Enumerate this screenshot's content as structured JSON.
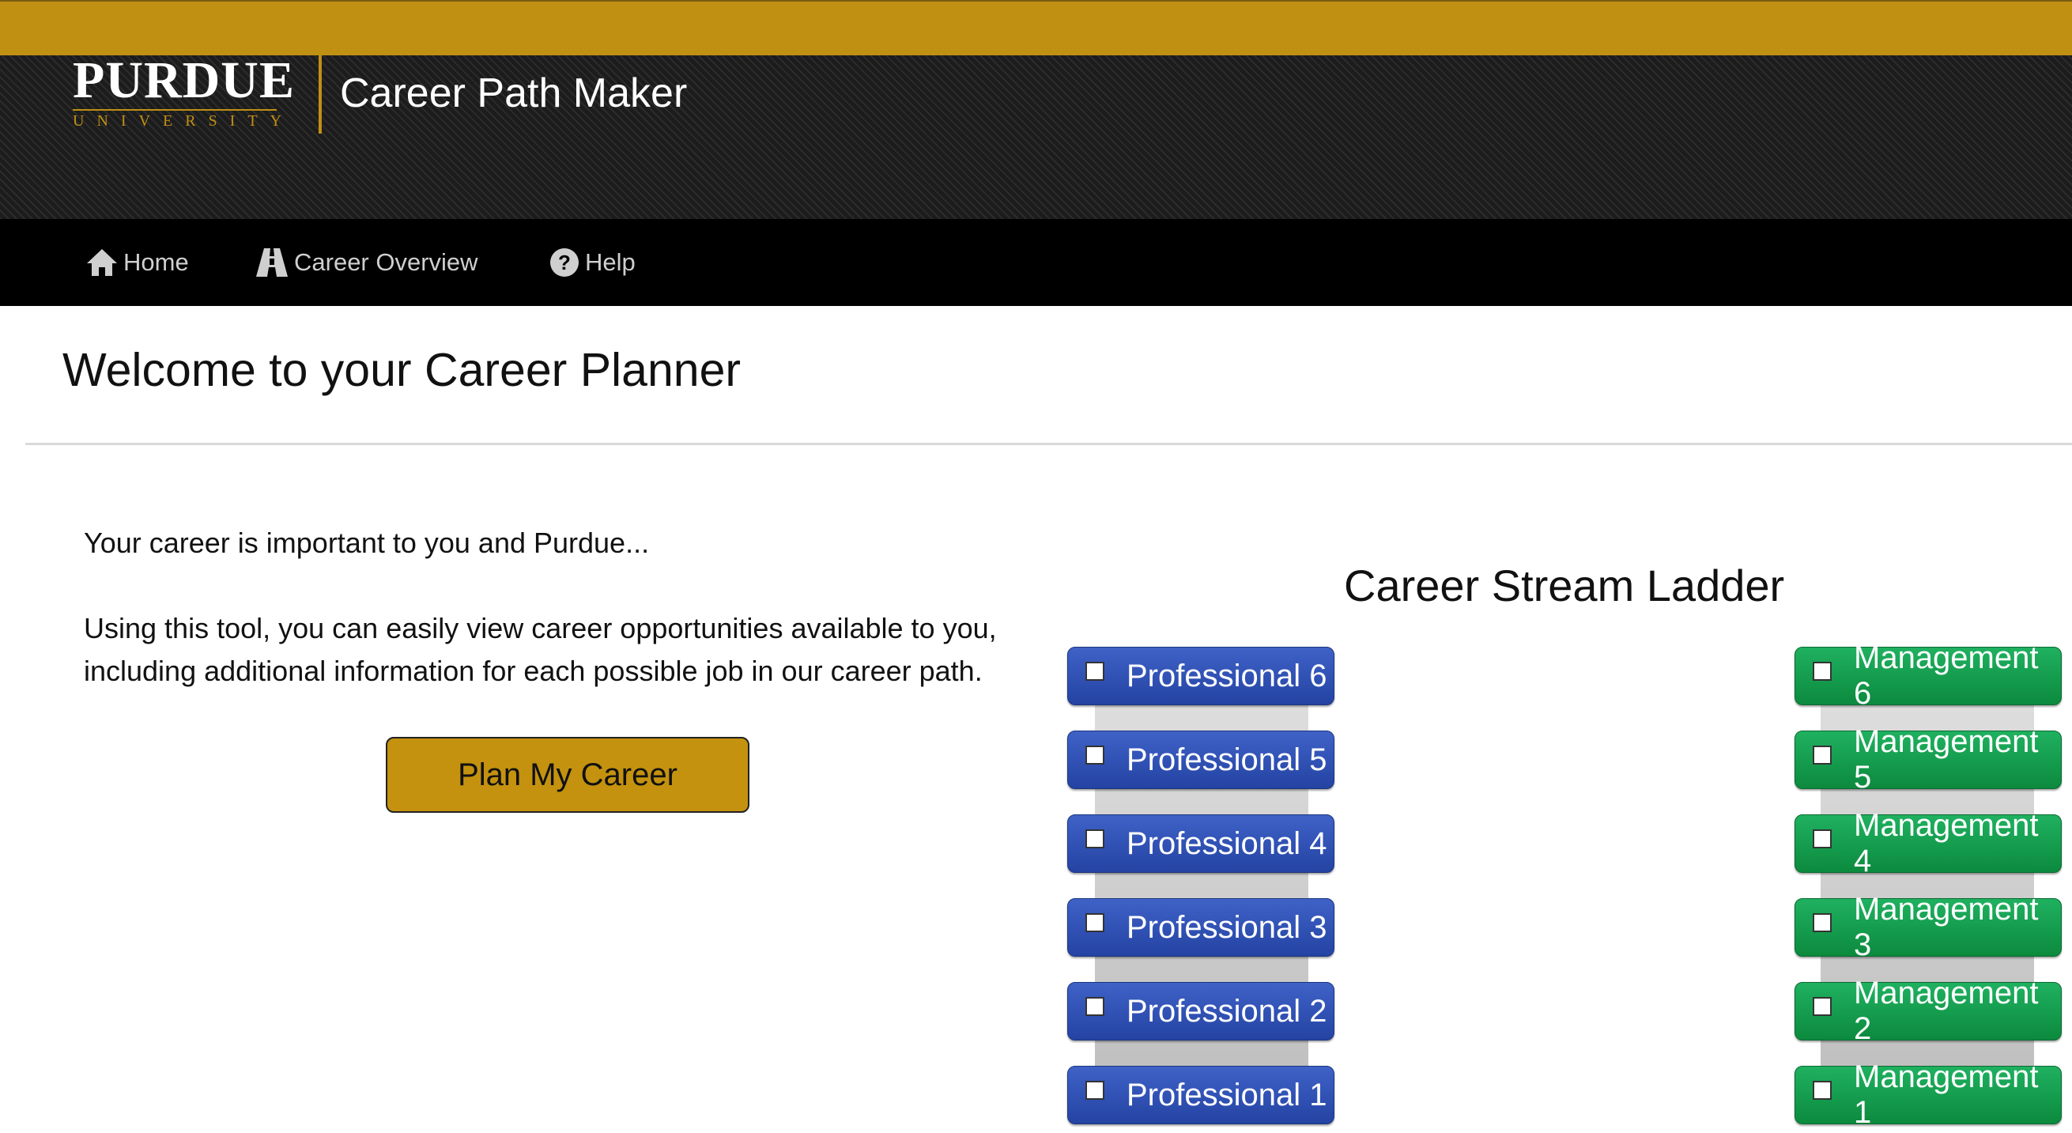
{
  "header": {
    "logo_word": "Purdue",
    "logo_sub": "UNIVERSITY",
    "app_title": "Career Path Maker"
  },
  "nav": {
    "items": [
      {
        "label": "Home",
        "icon": "home-icon"
      },
      {
        "label": "Career Overview",
        "icon": "road-icon"
      },
      {
        "label": "Help",
        "icon": "question-circle-icon"
      }
    ]
  },
  "main": {
    "page_title": "Welcome to your Career Planner",
    "intro_line1": "Your career is important to you and Purdue...",
    "intro_line2": "Using this tool, you can easily view career opportunities available to you, including additional information for each possible job in our career path.",
    "plan_button": "Plan My Career"
  },
  "ladder": {
    "title": "Career Stream Ladder",
    "professional": [
      "Professional 6",
      "Professional 5",
      "Professional 4",
      "Professional 3",
      "Professional 2",
      "Professional 1"
    ],
    "management": [
      "Management 6",
      "Management 5",
      "Management 4",
      "Management 3",
      "Management 2",
      "Management 1"
    ]
  },
  "colors": {
    "gold": "#c09013",
    "professional": "#2f50b5",
    "management": "#14a050",
    "nav_bg": "#000000"
  }
}
